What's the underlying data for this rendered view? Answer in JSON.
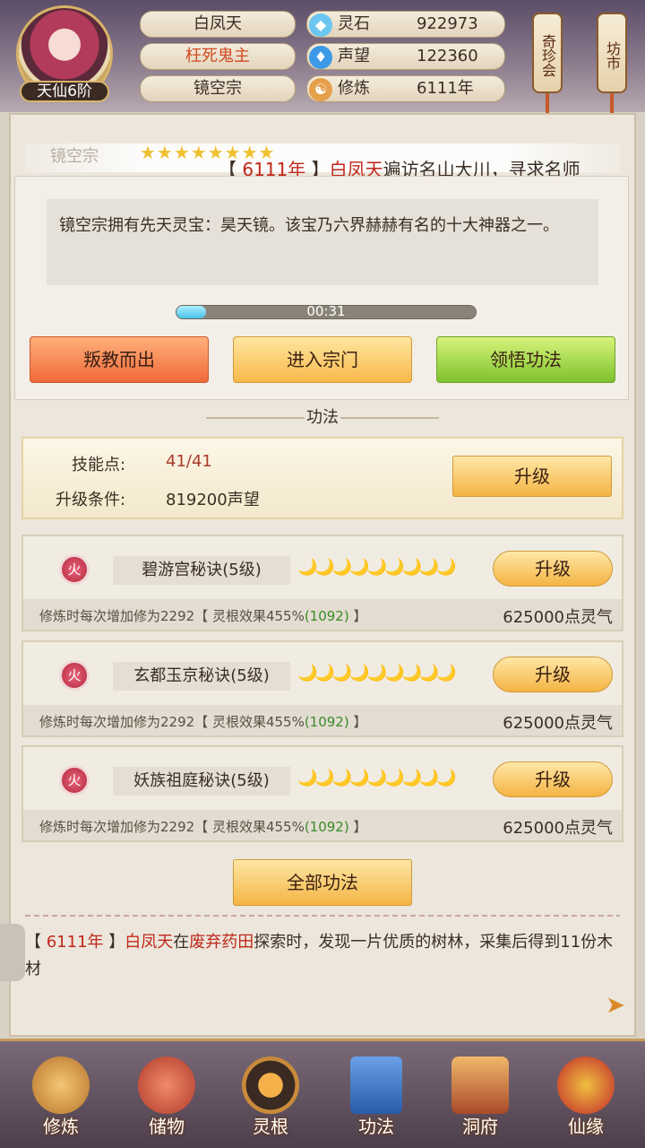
{
  "player": {
    "name": "白凤天",
    "title": "枉死鬼主",
    "sect": "镜空宗",
    "rank": "天仙6阶"
  },
  "stats": [
    {
      "icon": "spirit-stone-icon",
      "label": "灵石",
      "value": "922973"
    },
    {
      "icon": "reputation-icon",
      "label": "声望",
      "value": "122360"
    },
    {
      "icon": "cultivation-icon",
      "label": "修炼",
      "value": "6111年"
    }
  ],
  "shortcuts": {
    "treasure": "奇珍会",
    "market": "坊市"
  },
  "sect_bar": {
    "name": "镜空宗",
    "stars": "★★★★★★★★"
  },
  "marquee": {
    "year": "6111年",
    "name": "白凤天",
    "text": "遍访名山大川，寻求名师"
  },
  "description": "镜空宗拥有先天灵宝：昊天镜。该宝乃六界赫赫有名的十大神器之一。",
  "timer": {
    "text": "00:31",
    "fraction": 0.1
  },
  "actions": {
    "leave": "叛教而出",
    "enter": "进入宗门",
    "learn": "领悟功法"
  },
  "section_title": "功法",
  "skill": {
    "points_label": "技能点:",
    "points_value": "41/41",
    "cond_label": "升级条件:",
    "cond_value": "819200声望",
    "upgrade": "升级"
  },
  "techniques": [
    {
      "element": "火",
      "name": "碧游宫秘诀(5级)",
      "moons": "🌙🌙🌙🌙🌙🌙🌙🌙🌙",
      "upgrade": "升级",
      "desc": "修炼时每次增加修为2292【 灵根效果455%",
      "bonus": "(1092)",
      "desc_end": " 】",
      "cost": "625000点灵气"
    },
    {
      "element": "火",
      "name": "玄都玉京秘诀(5级)",
      "moons": "🌙🌙🌙🌙🌙🌙🌙🌙🌙",
      "upgrade": "升级",
      "desc": "修炼时每次增加修为2292【 灵根效果455%",
      "bonus": "(1092)",
      "desc_end": " 】",
      "cost": "625000点灵气"
    },
    {
      "element": "火",
      "name": "妖族祖庭秘诀(5级)",
      "moons": "🌙🌙🌙🌙🌙🌙🌙🌙🌙",
      "upgrade": "升级",
      "desc": "修炼时每次增加修为2292【 灵根效果455%",
      "bonus": "(1092)",
      "desc_end": " 】",
      "cost": "625000点灵气"
    }
  ],
  "all_techniques": "全部功法",
  "log": {
    "year": "6111年",
    "name": "白凤天",
    "mid": "在",
    "place": "废弃药田",
    "text": "探索时，发现一片优质的树林，采集后得到11份木材"
  },
  "nav": [
    {
      "label": "修炼",
      "icon": "cultivate-icon"
    },
    {
      "label": "储物",
      "icon": "storage-bag-icon"
    },
    {
      "label": "灵根",
      "icon": "spirit-root-icon"
    },
    {
      "label": "功法",
      "icon": "technique-book-icon"
    },
    {
      "label": "洞府",
      "icon": "cave-house-icon"
    },
    {
      "label": "仙缘",
      "icon": "fate-gourd-icon"
    }
  ],
  "colors": {
    "accent": "#f4b443",
    "danger": "#c0271a"
  }
}
